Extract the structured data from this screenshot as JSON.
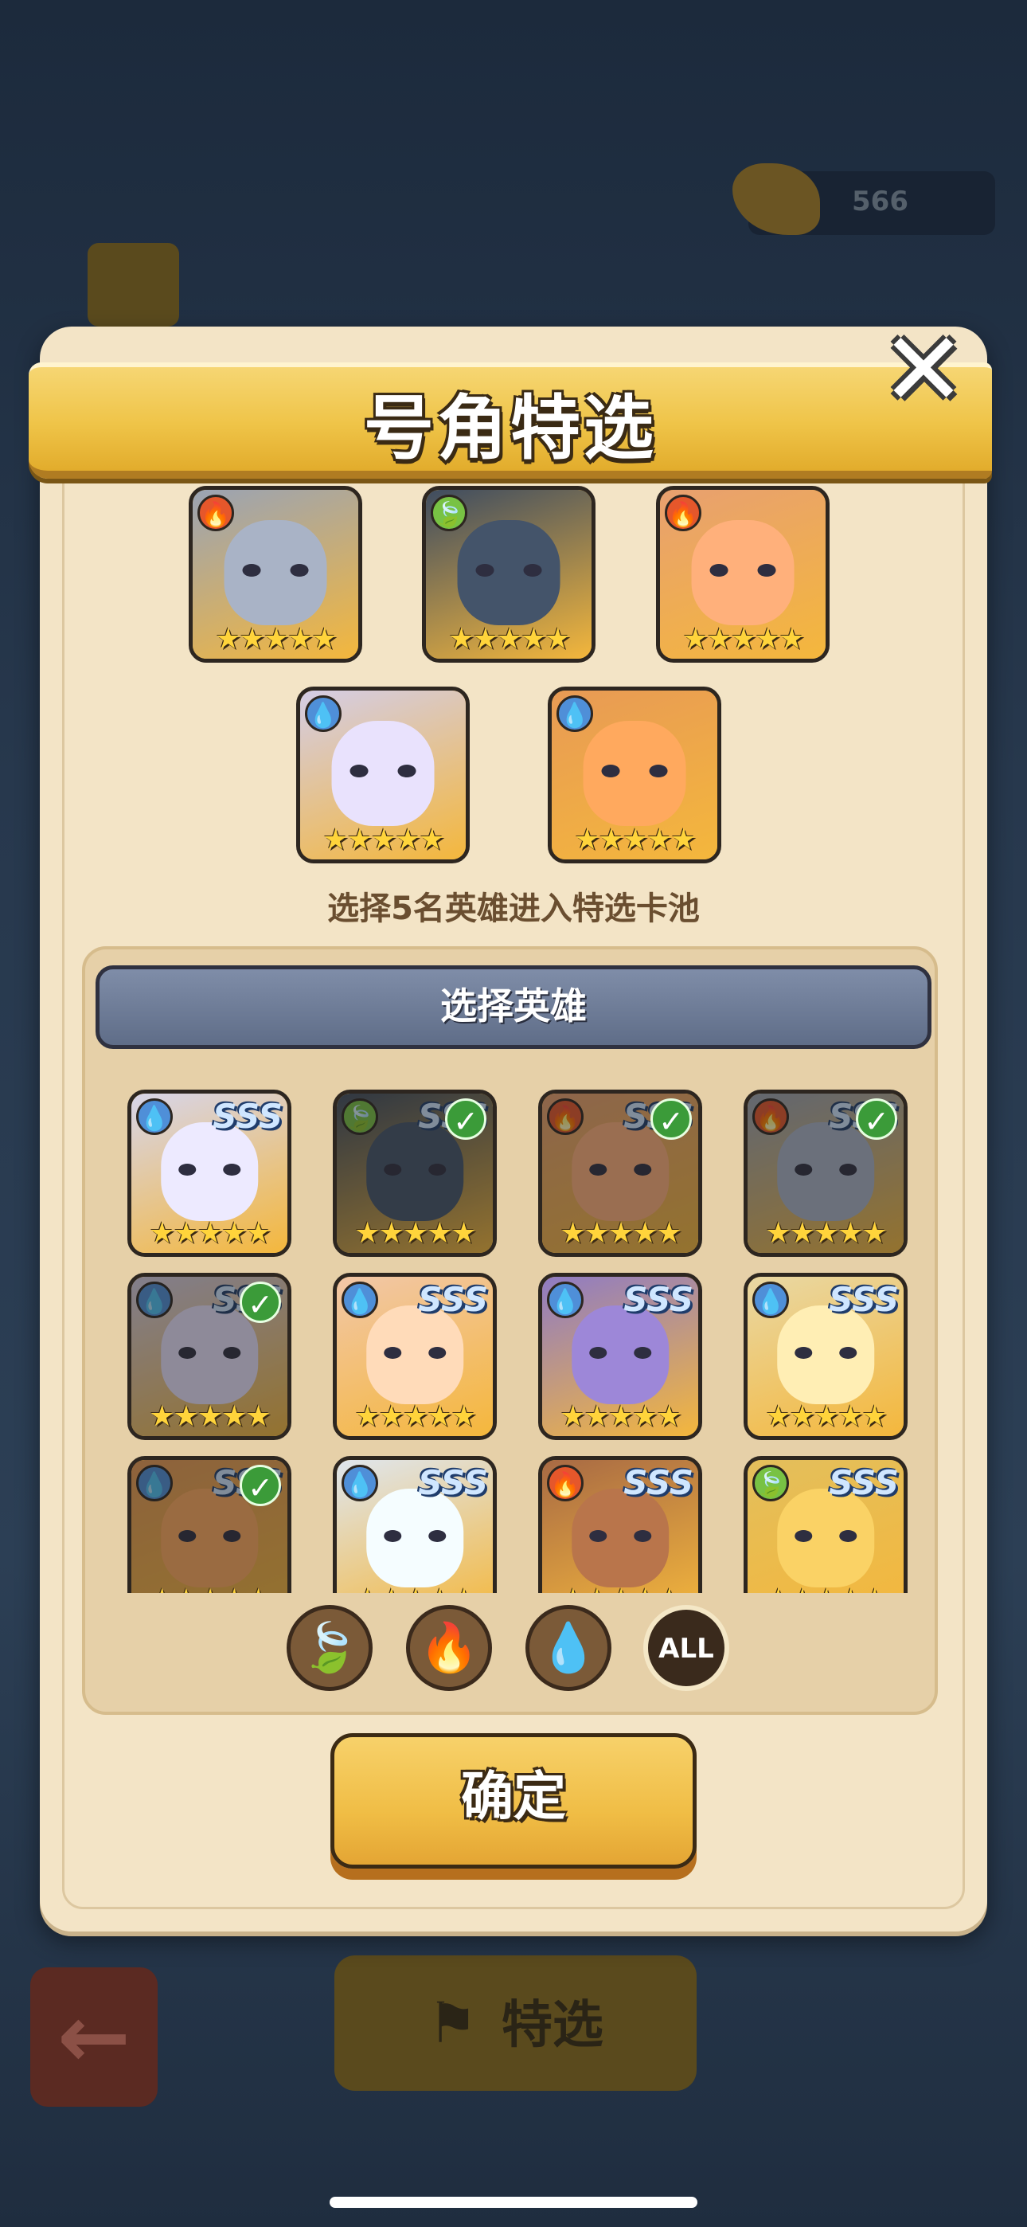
{
  "background": {
    "currency_value": "566",
    "select_button_label": "特选"
  },
  "dialog": {
    "title": "号角特选",
    "close_label": "✕",
    "caption": "选择5名英雄进入特选卡池",
    "pool_header": "选择英雄",
    "confirm_label": "确定"
  },
  "selected_heroes": [
    {
      "element": "fire",
      "stars": "★★★★★",
      "palette": "#9aa3b4"
    },
    {
      "element": "leaf",
      "stars": "★★★★★",
      "palette": "#3e4c60"
    },
    {
      "element": "fire",
      "stars": "★★★★★",
      "palette": "#e8a070"
    },
    {
      "element": "water",
      "stars": "★★★★★",
      "palette": "#d4cde6"
    },
    {
      "element": "water",
      "stars": "★★★★★",
      "palette": "#e89a55"
    }
  ],
  "hero_pool": [
    {
      "element": "water",
      "grade": "SSS",
      "stars": "★★★★★",
      "selected": false,
      "palette": "#d7d5ea"
    },
    {
      "element": "leaf",
      "grade": "SSS",
      "stars": "★★★★★",
      "selected": true,
      "palette": "#3e4c60"
    },
    {
      "element": "fire",
      "grade": "SSS",
      "stars": "★★★★★",
      "selected": true,
      "palette": "#e8a070"
    },
    {
      "element": "fire",
      "grade": "SSS",
      "stars": "★★★★★",
      "selected": true,
      "palette": "#9aa3b4"
    },
    {
      "element": "water",
      "grade": "SSS",
      "stars": "★★★★★",
      "selected": true,
      "palette": "#d4cde6"
    },
    {
      "element": "water",
      "grade": "SSS",
      "stars": "★★★★★",
      "selected": false,
      "palette": "#f2c7a8"
    },
    {
      "element": "water",
      "grade": "SSS",
      "stars": "★★★★★",
      "selected": false,
      "palette": "#8f7bc4"
    },
    {
      "element": "water",
      "grade": "SSS",
      "stars": "★★★★★",
      "selected": false,
      "palette": "#e9d8a4"
    },
    {
      "element": "water",
      "grade": "SSS",
      "stars": "★★★★★",
      "selected": true,
      "palette": "#e89a55"
    },
    {
      "element": "water",
      "grade": "SSS",
      "stars": "★★★★★",
      "selected": false,
      "palette": "#dfe6ee"
    },
    {
      "element": "fire",
      "grade": "SSS",
      "stars": "★★★★★",
      "selected": false,
      "palette": "#a86a44"
    },
    {
      "element": "leaf",
      "grade": "SSS",
      "stars": "★★★★★",
      "selected": false,
      "palette": "#e3bf5c"
    }
  ],
  "filters": [
    {
      "name": "leaf",
      "icon": "leaf-icon",
      "label": "🍃"
    },
    {
      "name": "fire",
      "icon": "fire-icon",
      "label": "🔥"
    },
    {
      "name": "water",
      "icon": "water-icon",
      "label": "💧"
    },
    {
      "name": "all",
      "icon": "all-icon",
      "label": "ALL"
    }
  ],
  "colors": {
    "banner": "#efc448",
    "panel": "#f3e4c6",
    "confirm": "#f0bd45"
  }
}
